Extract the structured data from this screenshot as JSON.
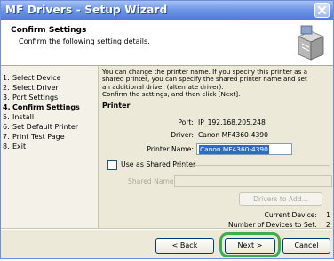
{
  "window": {
    "title": "MF Drivers - Setup Wizard"
  },
  "header": {
    "title": "Confirm Settings",
    "subtitle": "Confirm the following setting details."
  },
  "steps": [
    {
      "num": "1.",
      "label": "Select Device",
      "current": false
    },
    {
      "num": "2.",
      "label": "Select Driver",
      "current": false
    },
    {
      "num": "3.",
      "label": "Port Settings",
      "current": false
    },
    {
      "num": "4.",
      "label": "Confirm Settings",
      "current": true
    },
    {
      "num": "5.",
      "label": "Install",
      "current": false
    },
    {
      "num": "6.",
      "label": "Set Default Printer",
      "current": false
    },
    {
      "num": "7.",
      "label": "Print Test Page",
      "current": false
    },
    {
      "num": "8.",
      "label": "Exit",
      "current": false
    }
  ],
  "panel": {
    "intro_line1": "You can change the printer name. If you specify this printer as a",
    "intro_line2": "shared printer, you can specify the shared printer name and set",
    "intro_line3": "an additional driver (alternate driver).",
    "intro_line4": "Confirm the settings, and then click [Next].",
    "printer_heading": "Printer",
    "port_label": "Port:",
    "port_value": "IP_192.168.205.248",
    "driver_label": "Driver:",
    "driver_value": "Canon MF4360-4390",
    "name_label": "Printer Name:",
    "name_value": "Canon MF4360-4390",
    "shared_checkbox_label": "Use as Shared Printer",
    "shared_checked": false,
    "shared_name_label": "Shared Name:",
    "shared_name_value": "",
    "drivers_button": "Drivers to Add...",
    "current_device_label": "Current Device:",
    "current_device_value": "1",
    "devices_to_set_label": "Number of Devices to Set:",
    "devices_to_set_value": "2"
  },
  "footer": {
    "back_label": "< Back",
    "next_label": "Next >",
    "cancel_label": "Cancel"
  },
  "colors": {
    "title_bar": "#4d7ad8",
    "selection": "#316ac5",
    "highlight_ring": "#3eae4c"
  }
}
